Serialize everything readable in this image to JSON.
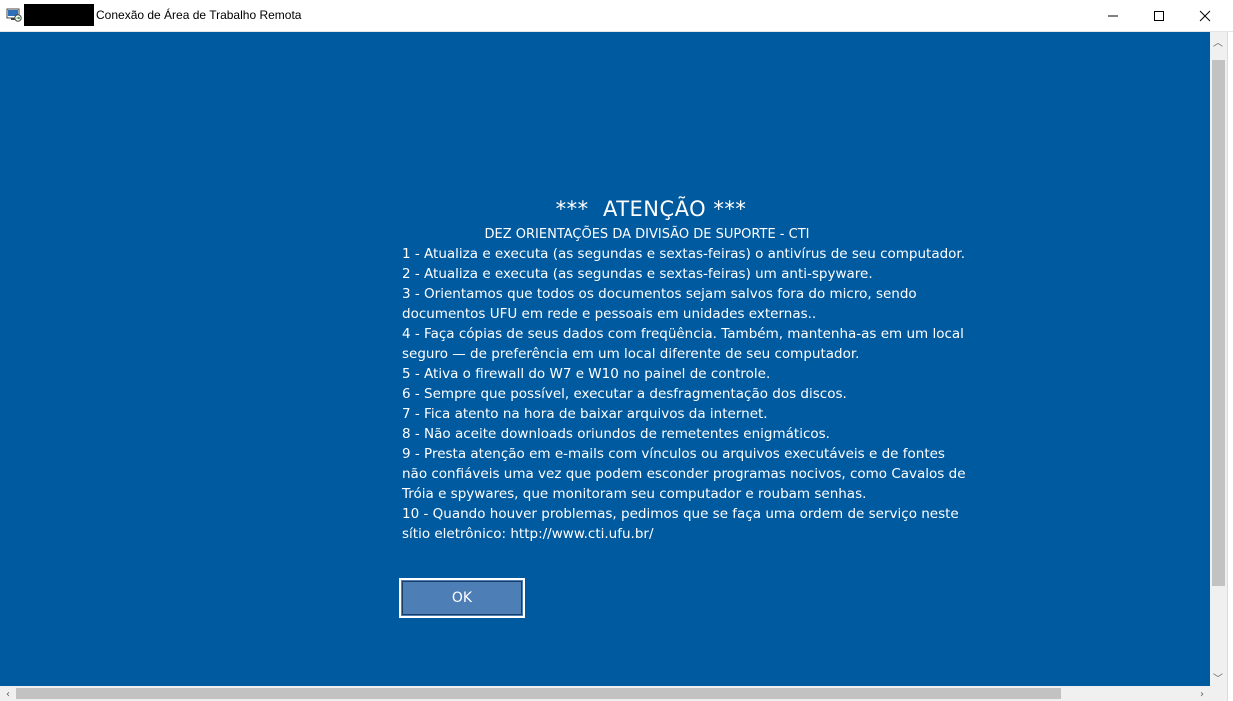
{
  "window": {
    "title": "Conexão de Área de Trabalho Remota"
  },
  "dialog": {
    "heading": "***  ATENÇÃO ***",
    "subheading": "DEZ ORIENTAÇÕES DA DIVISÃO DE SUPORTE - CTI",
    "items": [
      "1 - Atualiza e executa (as segundas e sextas-feiras) o antivírus de seu computador.",
      "2 - Atualiza e executa (as segundas e sextas-feiras)  um anti-spyware.",
      "3 - Orientamos que todos os documentos sejam salvos fora do micro, sendo documentos UFU em rede e pessoais em unidades externas..",
      "4 - Faça cópias de seus dados com freqüência. Também, mantenha-as em um local seguro — de preferência em um local diferente de seu computador.",
      "5 - Ativa o firewall do W7 e W10 no painel de controle.",
      "6 - Sempre que possível, executar a desfragmentação dos discos.",
      "7 - Fica atento na hora de baixar arquivos da internet.",
      "8 - Não aceite downloads oriundos de remetentes enigmáticos.",
      "9 - Presta atenção em e-mails com vínculos ou arquivos executáveis e de fontes não confiáveis uma vez que podem esconder programas nocivos, como Cavalos de Tróia e spywares, que monitoram seu computador e roubam senhas.",
      "10 - Quando houver problemas, pedimos que se faça uma ordem de serviço neste sítio eletrônico:   http://www.cti.ufu.br/"
    ],
    "ok_label": "OK"
  },
  "icons": {
    "app": "remote-desktop-icon",
    "minimize": "minimize-icon",
    "maximize": "maximize-icon",
    "close": "close-icon"
  },
  "colors": {
    "background": "#005aa0",
    "button": "#4d7eb5"
  }
}
